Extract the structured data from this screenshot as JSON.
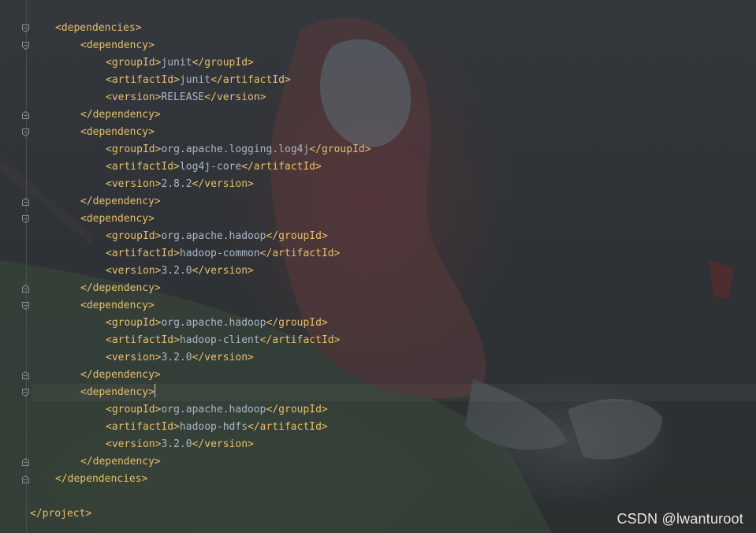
{
  "editor": {
    "lines": [
      {
        "indent": 1,
        "parts": [
          {
            "t": "tag",
            "v": "<dependencies>"
          }
        ]
      },
      {
        "indent": 2,
        "parts": [
          {
            "t": "tag",
            "v": "<dependency>"
          }
        ]
      },
      {
        "indent": 3,
        "parts": [
          {
            "t": "tag",
            "v": "<groupId>"
          },
          {
            "t": "txt",
            "v": "junit"
          },
          {
            "t": "tag",
            "v": "</groupId>"
          }
        ]
      },
      {
        "indent": 3,
        "parts": [
          {
            "t": "tag",
            "v": "<artifactId>"
          },
          {
            "t": "txt",
            "v": "junit"
          },
          {
            "t": "tag",
            "v": "</artifactId>"
          }
        ]
      },
      {
        "indent": 3,
        "parts": [
          {
            "t": "tag",
            "v": "<version>"
          },
          {
            "t": "txt",
            "v": "RELEASE"
          },
          {
            "t": "tag",
            "v": "</version>"
          }
        ]
      },
      {
        "indent": 2,
        "parts": [
          {
            "t": "tag",
            "v": "</dependency>"
          }
        ]
      },
      {
        "indent": 2,
        "parts": [
          {
            "t": "tag",
            "v": "<dependency>"
          }
        ]
      },
      {
        "indent": 3,
        "parts": [
          {
            "t": "tag",
            "v": "<groupId>"
          },
          {
            "t": "txt",
            "v": "org.apache.logging.log4j"
          },
          {
            "t": "tag",
            "v": "</groupId>"
          }
        ]
      },
      {
        "indent": 3,
        "parts": [
          {
            "t": "tag",
            "v": "<artifactId>"
          },
          {
            "t": "txt",
            "v": "log4j-core"
          },
          {
            "t": "tag",
            "v": "</artifactId>"
          }
        ]
      },
      {
        "indent": 3,
        "parts": [
          {
            "t": "tag",
            "v": "<version>"
          },
          {
            "t": "txt",
            "v": "2.8.2"
          },
          {
            "t": "tag",
            "v": "</version>"
          }
        ]
      },
      {
        "indent": 2,
        "parts": [
          {
            "t": "tag",
            "v": "</dependency>"
          }
        ]
      },
      {
        "indent": 2,
        "parts": [
          {
            "t": "tag",
            "v": "<dependency>"
          }
        ]
      },
      {
        "indent": 3,
        "parts": [
          {
            "t": "tag",
            "v": "<groupId>"
          },
          {
            "t": "txt",
            "v": "org.apache.hadoop"
          },
          {
            "t": "tag",
            "v": "</groupId>"
          }
        ]
      },
      {
        "indent": 3,
        "parts": [
          {
            "t": "tag",
            "v": "<artifactId>"
          },
          {
            "t": "txt",
            "v": "hadoop-common"
          },
          {
            "t": "tag",
            "v": "</artifactId>"
          }
        ]
      },
      {
        "indent": 3,
        "parts": [
          {
            "t": "tag",
            "v": "<version>"
          },
          {
            "t": "txt",
            "v": "3.2.0"
          },
          {
            "t": "tag",
            "v": "</version>"
          }
        ]
      },
      {
        "indent": 2,
        "parts": [
          {
            "t": "tag",
            "v": "</dependency>"
          }
        ]
      },
      {
        "indent": 2,
        "parts": [
          {
            "t": "tag",
            "v": "<dependency>"
          }
        ]
      },
      {
        "indent": 3,
        "parts": [
          {
            "t": "tag",
            "v": "<groupId>"
          },
          {
            "t": "txt",
            "v": "org.apache.hadoop"
          },
          {
            "t": "tag",
            "v": "</groupId>"
          }
        ]
      },
      {
        "indent": 3,
        "parts": [
          {
            "t": "tag",
            "v": "<artifactId>"
          },
          {
            "t": "txt",
            "v": "hadoop-client"
          },
          {
            "t": "tag",
            "v": "</artifactId>"
          }
        ]
      },
      {
        "indent": 3,
        "parts": [
          {
            "t": "tag",
            "v": "<version>"
          },
          {
            "t": "txt",
            "v": "3.2.0"
          },
          {
            "t": "tag",
            "v": "</version>"
          }
        ]
      },
      {
        "indent": 2,
        "parts": [
          {
            "t": "tag",
            "v": "</dependency>"
          }
        ]
      },
      {
        "indent": 2,
        "caret": true,
        "parts": [
          {
            "t": "tag",
            "v": "<dependency>"
          }
        ]
      },
      {
        "indent": 3,
        "parts": [
          {
            "t": "tag",
            "v": "<groupId>"
          },
          {
            "t": "txt",
            "v": "org.apache.hadoop"
          },
          {
            "t": "tag",
            "v": "</groupId>"
          }
        ]
      },
      {
        "indent": 3,
        "parts": [
          {
            "t": "tag",
            "v": "<artifactId>"
          },
          {
            "t": "txt",
            "v": "hadoop-hdfs"
          },
          {
            "t": "tag",
            "v": "</artifactId>"
          }
        ]
      },
      {
        "indent": 3,
        "parts": [
          {
            "t": "tag",
            "v": "<version>"
          },
          {
            "t": "txt",
            "v": "3.2.0"
          },
          {
            "t": "tag",
            "v": "</version>"
          }
        ]
      },
      {
        "indent": 2,
        "parts": [
          {
            "t": "tag",
            "v": "</dependency>"
          }
        ]
      },
      {
        "indent": 1,
        "parts": [
          {
            "t": "tag",
            "v": "</dependencies>"
          }
        ]
      },
      {
        "indent": 0,
        "parts": []
      },
      {
        "indent": 0,
        "parts": [
          {
            "t": "tag",
            "v": "</project>"
          }
        ]
      }
    ]
  },
  "colors": {
    "tag": "#e8bf6a",
    "text": "#a9b7c6",
    "background": "#2b2d31",
    "gutter_line": "#4a4d52"
  },
  "watermark": "CSDN @lwanturoot"
}
